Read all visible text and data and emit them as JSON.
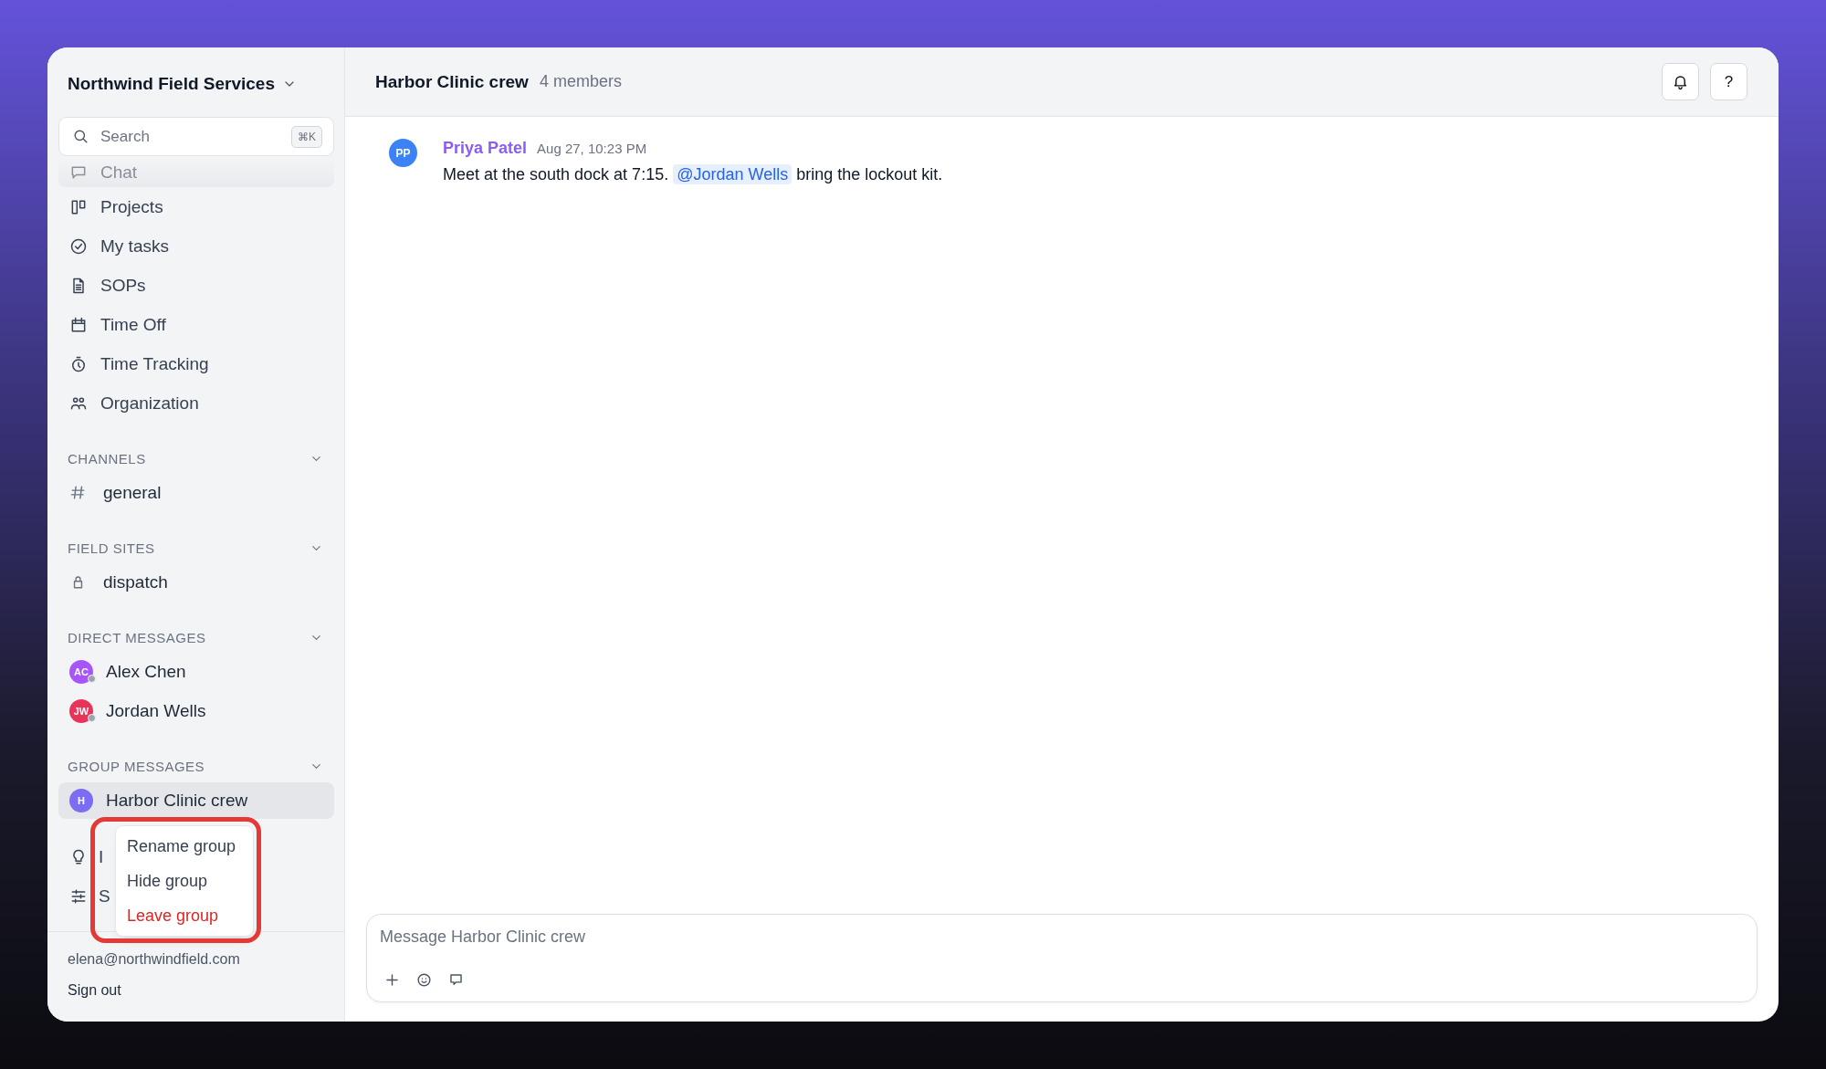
{
  "workspace": {
    "name": "Northwind Field Services"
  },
  "search": {
    "placeholder": "Search",
    "shortcut": "⌘K"
  },
  "nav": [
    {
      "kind": "chat",
      "label": "Chat",
      "partly_hidden": true
    },
    {
      "kind": "projects",
      "label": "Projects",
      "partly_hidden": false
    },
    {
      "kind": "tasks",
      "label": "My tasks",
      "partly_hidden": false
    },
    {
      "kind": "document",
      "label": "SOPs",
      "partly_hidden": false
    },
    {
      "kind": "calendar",
      "label": "Time Off",
      "partly_hidden": false
    },
    {
      "kind": "timer",
      "label": "Time Tracking",
      "partly_hidden": false
    },
    {
      "kind": "people",
      "label": "Organization",
      "partly_hidden": false
    }
  ],
  "sections": [
    {
      "title": "CHANNELS",
      "expanded": true,
      "items": [
        {
          "kind": "channel",
          "label": "general",
          "selected": false
        }
      ]
    },
    {
      "title": "FIELD SITES",
      "expanded": true,
      "items": [
        {
          "kind": "private",
          "label": "dispatch",
          "selected": false
        }
      ]
    },
    {
      "title": "DIRECT MESSAGES",
      "expanded": true,
      "items": [
        {
          "kind": "person",
          "initials": "AC",
          "label": "Alex Chen",
          "color": "#a855f7",
          "online": false,
          "selected": false
        },
        {
          "kind": "person",
          "initials": "JW",
          "label": "Jordan Wells",
          "color": "#e9345a",
          "online": false,
          "selected": false
        }
      ]
    },
    {
      "title": "GROUP MESSAGES",
      "expanded": true,
      "items": [
        {
          "kind": "group",
          "initials": "H",
          "label": "Harbor Clinic crew",
          "color": "#7c6cf2",
          "selected": true
        }
      ]
    }
  ],
  "extra_nav": [
    {
      "kind": "idea",
      "label": "I"
    },
    {
      "kind": "settings",
      "label": "S"
    }
  ],
  "context_menu": {
    "items": [
      {
        "label": "Rename group",
        "danger": false
      },
      {
        "label": "Hide group",
        "danger": false
      },
      {
        "label": "Leave group",
        "danger": true
      }
    ]
  },
  "account": {
    "email": "elena@northwindfield.com",
    "sign_out": "Sign out"
  },
  "conversation": {
    "title": "Harbor Clinic crew",
    "members": "4 members",
    "buttons": [
      {
        "kind": "bell"
      },
      {
        "kind": "help",
        "label": "?"
      }
    ]
  },
  "messages": [
    {
      "initials": "PP",
      "color": "#3b82f6",
      "author": "Priya Patel",
      "time": "Aug 27, 10:23 PM",
      "parts": [
        {
          "kind": "text",
          "text": "Meet at the south dock at 7:15. "
        },
        {
          "kind": "mention",
          "text": "@Jordan Wells"
        },
        {
          "kind": "text",
          "text": " bring the lockout kit."
        }
      ]
    }
  ],
  "composer": {
    "placeholder": "Message Harbor Clinic crew",
    "tools": [
      {
        "kind": "plus"
      },
      {
        "kind": "emoji"
      },
      {
        "kind": "comment"
      }
    ]
  }
}
